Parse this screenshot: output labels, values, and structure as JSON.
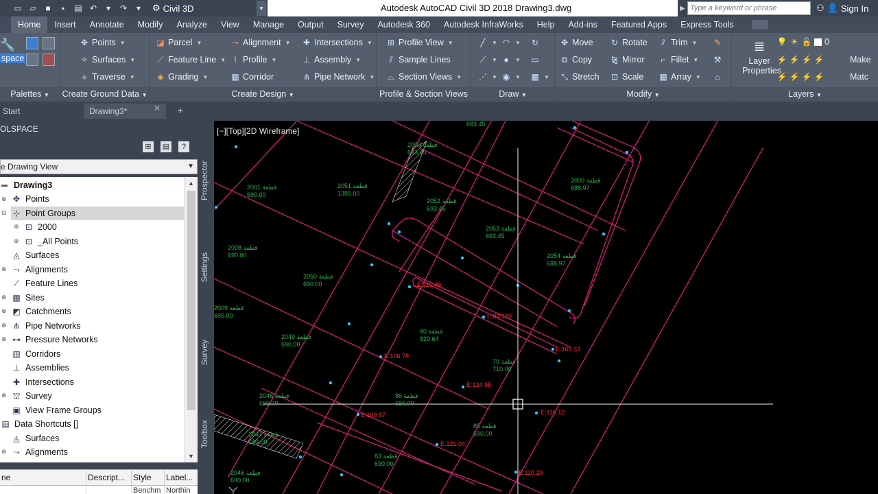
{
  "titlebar": {
    "workspace": "Civil 3D",
    "app_title": "Autodesk AutoCAD Civil 3D 2018    Drawing3.dwg",
    "search_placeholder": "Type a keyword or phrase",
    "sign_in": "Sign In"
  },
  "ribbon_tabs": [
    "Home",
    "Insert",
    "Annotate",
    "Modify",
    "Analyze",
    "View",
    "Manage",
    "Output",
    "Survey",
    "Autodesk 360",
    "Autodesk InfraWorks",
    "Help",
    "Add-ins",
    "Featured Apps",
    "Express Tools"
  ],
  "ribbon": {
    "toolspace_label": "space",
    "palettes_label": "Palettes",
    "ground": {
      "title": "Create Ground Data",
      "points": "Points",
      "surfaces": "Surfaces",
      "traverse": "Traverse"
    },
    "design": {
      "title": "Create Design",
      "parcel": "Parcel",
      "feature_line": "Feature Line",
      "grading": "Grading",
      "alignment": "Alignment",
      "profile": "Profile",
      "corridor": "Corridor",
      "intersections": "Intersections",
      "assembly": "Assembly",
      "pipe_network": "Pipe Network"
    },
    "views": {
      "title": "Profile & Section Views",
      "profile_view": "Profile View",
      "sample_lines": "Sample Lines",
      "section_views": "Section Views"
    },
    "draw": {
      "title": "Draw"
    },
    "modify": {
      "title": "Modify",
      "move": "Move",
      "copy": "Copy",
      "stretch": "Stretch",
      "rotate": "Rotate",
      "mirror": "Mirror",
      "scale": "Scale",
      "trim": "Trim",
      "fillet": "Fillet",
      "array": "Array"
    },
    "layers": {
      "title": "Layers",
      "layer_properties": "Layer Properties",
      "layer_value": "0",
      "make": "Make",
      "match": "Matc"
    }
  },
  "file_tabs": {
    "start": "Start",
    "drawing": "Drawing3*"
  },
  "toolspace": {
    "header": "OLSPACE",
    "view_select": "e Drawing View",
    "tree": [
      {
        "label": "Drawing3",
        "bold": true
      },
      {
        "label": "Points"
      },
      {
        "label": "Point Groups",
        "selected": true
      },
      {
        "label": "2000"
      },
      {
        "label": "_All Points"
      },
      {
        "label": "Surfaces"
      },
      {
        "label": "Alignments"
      },
      {
        "label": "Feature Lines"
      },
      {
        "label": "Sites"
      },
      {
        "label": "Catchments"
      },
      {
        "label": "Pipe Networks"
      },
      {
        "label": "Pressure Networks"
      },
      {
        "label": "Corridors"
      },
      {
        "label": "Assemblies"
      },
      {
        "label": "Intersections"
      },
      {
        "label": "Survey"
      },
      {
        "label": "View Frame Groups"
      },
      {
        "label": "Data Shortcuts []"
      },
      {
        "label": "Surfaces"
      },
      {
        "label": "Alignments"
      }
    ],
    "side_tabs": [
      "Prospector",
      "Settings",
      "Survey",
      "Toolbox"
    ],
    "list_columns": [
      "ne",
      "Descript...",
      "Style",
      "Label..."
    ],
    "list_row": [
      "",
      "",
      "Benchm",
      "Northin"
    ]
  },
  "viewport": {
    "label": "[−][Top][2D Wireframe]",
    "parcel_labels": [
      {
        "name": "قطعة",
        "num": "2001",
        "area": "693.45"
      },
      {
        "name": "قطعة",
        "num": "2003",
        "area": "693.45"
      },
      {
        "name": "قطعة",
        "num": "2001",
        "area": "690.00"
      },
      {
        "name": "قطعة",
        "num": "2051",
        "area": "1380.00"
      },
      {
        "name": "قطعة",
        "num": "2052",
        "area": "693.45"
      },
      {
        "name": "قطعة",
        "num": "2000",
        "area": "688.97"
      },
      {
        "name": "قطعة",
        "num": "2053",
        "area": "693.45"
      },
      {
        "name": "قطعة",
        "num": "2054",
        "area": "688.97"
      },
      {
        "name": "قطعة",
        "num": "2008",
        "area": "690.00"
      },
      {
        "name": "قطعة",
        "num": "2050",
        "area": "690.00"
      },
      {
        "name": "قطعة",
        "num": "2009",
        "area": "690.00"
      },
      {
        "name": "قطعة",
        "num": "2049",
        "area": "690.00"
      },
      {
        "name": "قطعة",
        "num": "80",
        "area": "820.64"
      },
      {
        "name": "قطعة",
        "num": "79",
        "area": "710.00"
      },
      {
        "name": "قطعة",
        "num": "2048",
        "area": "690.00"
      },
      {
        "name": "قطعة",
        "num": "86",
        "area": "690.00"
      },
      {
        "name": "قطعة",
        "num": "85",
        "area": "690.00"
      },
      {
        "name": "قطعة",
        "num": "2047",
        "area": "180.00"
      },
      {
        "name": "قطعة",
        "num": "83",
        "area": "690.00"
      },
      {
        "name": "قطعة",
        "num": "2046",
        "area": "690.00"
      }
    ],
    "point_labels": [
      "E:119.46",
      "E:84.189",
      "E:168.33",
      "E:106.78",
      "E:134.95",
      "E:116.12",
      "E:109.87",
      "E:121.04",
      "E:110.20"
    ]
  }
}
